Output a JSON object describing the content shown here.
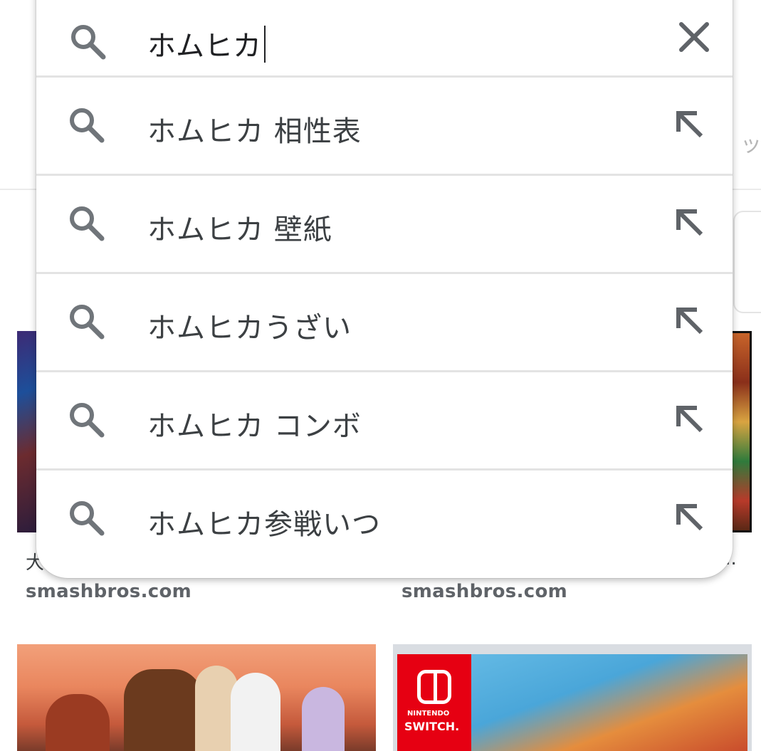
{
  "search": {
    "query": "ホムヒカ"
  },
  "suggestions": [
    {
      "text": "ホムヒカ 相性表"
    },
    {
      "text": "ホムヒカ 壁紙"
    },
    {
      "text": "ホムヒカうざい"
    },
    {
      "text": "ホムヒカ コンボ"
    },
    {
      "text": "ホムヒカ参戦いつ"
    }
  ],
  "background": {
    "edge_char": "ッ",
    "results": [
      {
        "caption": "大",
        "source": "smashbros.com"
      },
      {
        "caption": "...",
        "source": "smashbros.com"
      }
    ],
    "switch_label": {
      "small": "NINTENDO",
      "big": "SWITCH."
    }
  },
  "icons": {
    "search": "search-icon",
    "clear": "close-icon",
    "fill": "arrow-up-left-icon"
  },
  "colors": {
    "icon_gray": "#70757a",
    "text": "#3c4043",
    "divider": "#e3e3e3"
  }
}
